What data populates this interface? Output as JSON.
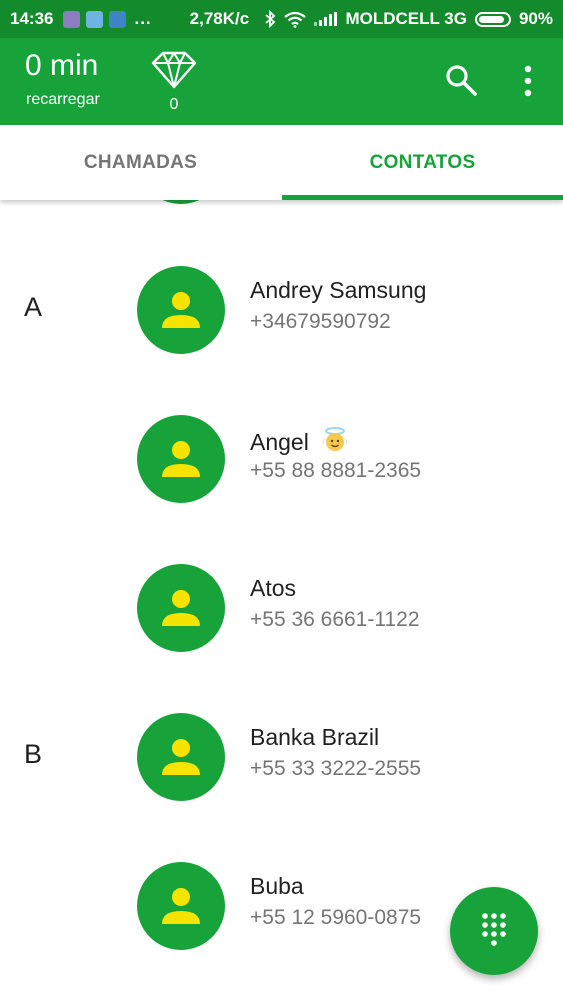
{
  "status_bar": {
    "time": "14:36",
    "more_notifications": "...",
    "network_speed": "2,78K/c",
    "carrier": "MOLDCELL 3G",
    "battery_percent": "90%",
    "battery_level": 0.9,
    "notification_colors": [
      "#8e7cc3",
      "#6fb3e0",
      "#3d85c6"
    ],
    "icons": [
      "bluetooth-icon",
      "wifi-icon",
      "signal-icon",
      "battery-icon"
    ]
  },
  "header": {
    "balance_value": "0 min",
    "balance_label": "recarregar",
    "diamond_count": "0",
    "icons": [
      "diamond-icon",
      "search-icon",
      "more-vert-icon"
    ]
  },
  "tabs": [
    {
      "label": "CHAMADAS",
      "active": false
    },
    {
      "label": "CONTATOS",
      "active": true
    }
  ],
  "contacts": [
    {
      "section": "A",
      "name": "Andrey Samsung",
      "phone": "+34679590792",
      "emoji": ""
    },
    {
      "section": "",
      "name": "Angel",
      "phone": "+55 88 8881-2365",
      "emoji": "angel-face-emoji"
    },
    {
      "section": "",
      "name": "Atos",
      "phone": "+55 36 6661-1122",
      "emoji": ""
    },
    {
      "section": "B",
      "name": "Banka Brazil",
      "phone": "+55 33 3222-2555",
      "emoji": ""
    },
    {
      "section": "",
      "name": "Buba",
      "phone": "+55 12 5960-0875",
      "emoji": ""
    }
  ],
  "fab": {
    "icon": "dialpad-icon"
  },
  "colors": {
    "status_bar": "#138a2c",
    "primary": "#17a33a",
    "avatar_person": "#f7e300",
    "text_primary": "#212121",
    "text_secondary": "#757575",
    "tab_inactive": "#757575"
  }
}
